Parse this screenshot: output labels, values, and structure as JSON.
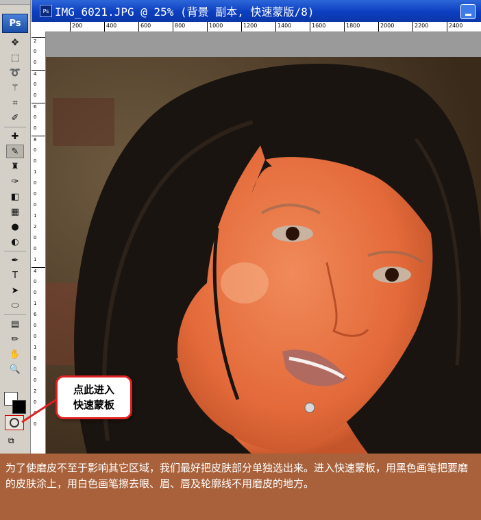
{
  "app": {
    "logo": "Ps"
  },
  "document": {
    "title": "IMG_6021.JPG @ 25% (背景 副本, 快速蒙版/8)",
    "icon_label": "Ps"
  },
  "ruler_h": [
    "200",
    "400",
    "600",
    "800",
    "1000",
    "1200",
    "1400",
    "1600",
    "1800",
    "2000",
    "2200",
    "2400"
  ],
  "ruler_v": [
    "2",
    "0",
    "0",
    "4",
    "0",
    "0",
    "6",
    "0",
    "0",
    "8",
    "0",
    "0",
    "1",
    "0",
    "0",
    "0",
    "1",
    "2",
    "0",
    "0",
    "1",
    "4",
    "0",
    "0",
    "1",
    "6",
    "0",
    "0",
    "1",
    "8",
    "0",
    "0",
    "2",
    "0",
    "0",
    "0"
  ],
  "tools": [
    {
      "name": "move-tool-icon",
      "glyph": "✥"
    },
    {
      "name": "marquee-tool-icon",
      "glyph": "⬚"
    },
    {
      "name": "lasso-tool-icon",
      "glyph": "➰"
    },
    {
      "name": "magic-wand-tool-icon",
      "glyph": "⚚"
    },
    {
      "name": "crop-tool-icon",
      "glyph": "⌗"
    },
    {
      "name": "slice-tool-icon",
      "glyph": "✐"
    },
    {
      "name": "healing-brush-tool-icon",
      "glyph": "✚"
    },
    {
      "name": "brush-tool-icon",
      "glyph": "✎"
    },
    {
      "name": "clone-stamp-tool-icon",
      "glyph": "♜"
    },
    {
      "name": "history-brush-tool-icon",
      "glyph": "✑"
    },
    {
      "name": "eraser-tool-icon",
      "glyph": "◧"
    },
    {
      "name": "gradient-tool-icon",
      "glyph": "▦"
    },
    {
      "name": "blur-tool-icon",
      "glyph": "●"
    },
    {
      "name": "dodge-tool-icon",
      "glyph": "◐"
    },
    {
      "name": "pen-tool-icon",
      "glyph": "✒"
    },
    {
      "name": "type-tool-icon",
      "glyph": "T"
    },
    {
      "name": "path-selection-tool-icon",
      "glyph": "➤"
    },
    {
      "name": "shape-tool-icon",
      "glyph": "⬭"
    },
    {
      "name": "notes-tool-icon",
      "glyph": "▤"
    },
    {
      "name": "eyedropper-tool-icon",
      "glyph": "✏"
    },
    {
      "name": "hand-tool-icon",
      "glyph": "✋"
    },
    {
      "name": "zoom-tool-icon",
      "glyph": "🔍"
    }
  ],
  "callout": {
    "line1": "点此进入",
    "line2": "快速蒙板"
  },
  "caption": "为了使磨皮不至于影响其它区域，我们最好把皮肤部分单独选出来。进入快速蒙板，用黑色画笔把要磨的皮肤涂上，用白色画笔擦去眼、眉、唇及轮廓线不用磨皮的地方。",
  "colors": {
    "titlebar": "#0c3ec0",
    "caption_bg": "#a8613a",
    "callout_border": "#e02020",
    "mask_overlay": "#e86a3c"
  }
}
